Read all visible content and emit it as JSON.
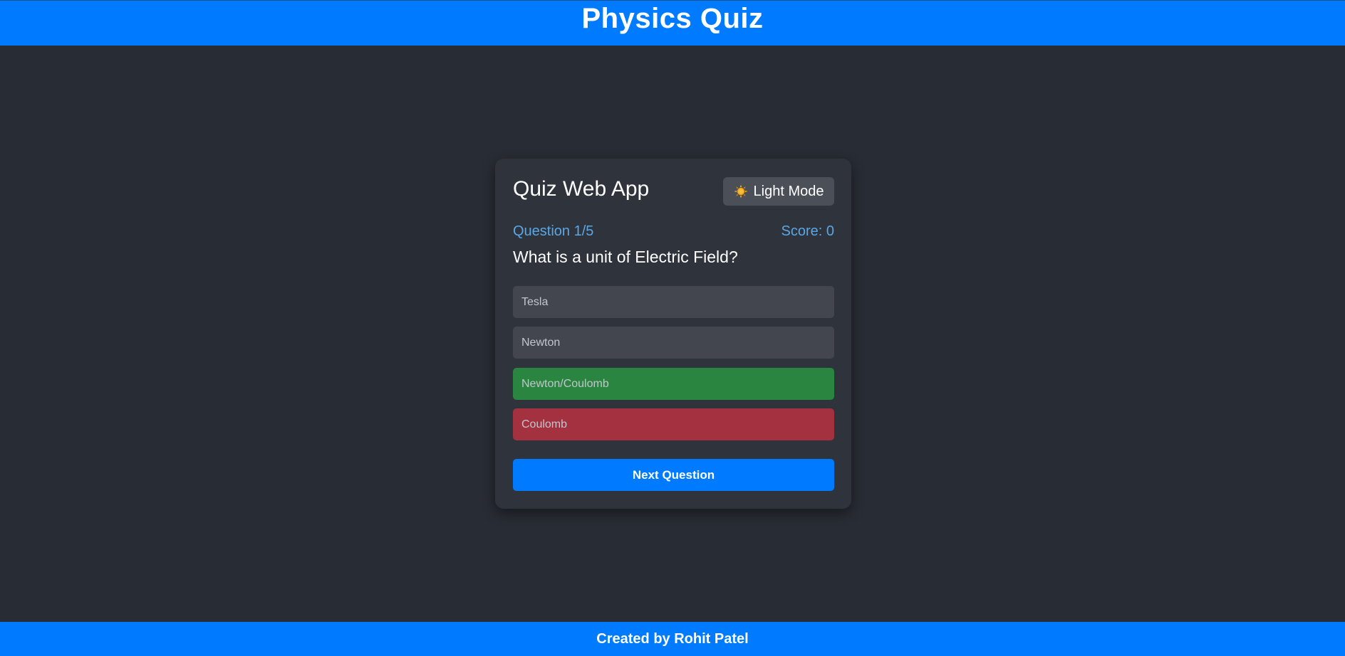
{
  "header": {
    "title": "Physics Quiz"
  },
  "card": {
    "title": "Quiz Web App",
    "mode_button": {
      "icon": "sun-icon",
      "label": "Light Mode"
    },
    "progress": "Question 1/5",
    "score": "Score: 0",
    "question": "What is a unit of Electric Field?",
    "answers": [
      {
        "label": "Tesla",
        "state": "neutral"
      },
      {
        "label": "Newton",
        "state": "neutral"
      },
      {
        "label": "Newton/Coulomb",
        "state": "correct"
      },
      {
        "label": "Coulomb",
        "state": "wrong"
      }
    ],
    "next_label": "Next Question"
  },
  "footer": {
    "text": "Created by Rohit Patel"
  },
  "colors": {
    "background": "#282c34",
    "card": "#2f333c",
    "accent": "#007bff",
    "meta_text": "#5aa7e6",
    "answer_neutral": "#43464f",
    "answer_correct": "#29853f",
    "answer_wrong": "#a3313f"
  }
}
